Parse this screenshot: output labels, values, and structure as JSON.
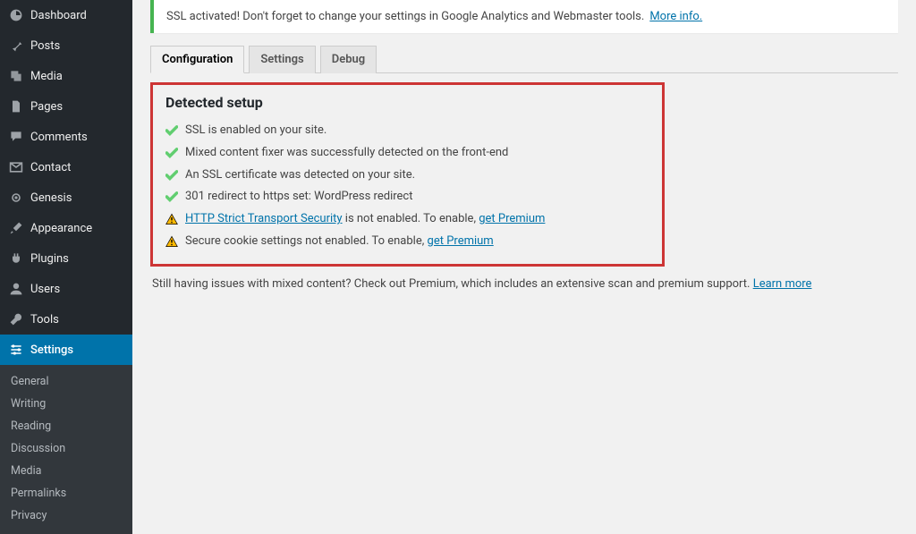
{
  "sidebar": {
    "items": [
      {
        "label": "Dashboard"
      },
      {
        "label": "Posts"
      },
      {
        "label": "Media"
      },
      {
        "label": "Pages"
      },
      {
        "label": "Comments"
      },
      {
        "label": "Contact"
      },
      {
        "label": "Genesis"
      },
      {
        "label": "Appearance"
      },
      {
        "label": "Plugins"
      },
      {
        "label": "Users"
      },
      {
        "label": "Tools"
      },
      {
        "label": "Settings"
      }
    ],
    "submenu": [
      {
        "label": "General"
      },
      {
        "label": "Writing"
      },
      {
        "label": "Reading"
      },
      {
        "label": "Discussion"
      },
      {
        "label": "Media"
      },
      {
        "label": "Permalinks"
      },
      {
        "label": "Privacy"
      }
    ]
  },
  "notice": {
    "text": "SSL activated!  Don't forget to change your settings in Google Analytics and Webmaster tools.",
    "link": "More info."
  },
  "tabs": [
    {
      "label": "Configuration"
    },
    {
      "label": "Settings"
    },
    {
      "label": "Debug"
    }
  ],
  "panel": {
    "title": "Detected setup",
    "lines": [
      {
        "status": "ok",
        "text": "SSL is enabled on your site."
      },
      {
        "status": "ok",
        "text": "Mixed content fixer was successfully detected on the front-end"
      },
      {
        "status": "ok",
        "text": "An SSL certificate was detected on your site."
      },
      {
        "status": "ok",
        "text": "301 redirect to https set: WordPress redirect"
      },
      {
        "status": "warn",
        "link1": "HTTP Strict Transport Security",
        "mid": " is not enabled. To enable, ",
        "link2": "get Premium"
      },
      {
        "status": "warn",
        "text": "Secure cookie settings not enabled. To enable, ",
        "link2": "get Premium"
      }
    ]
  },
  "bottom": {
    "text": "Still having issues with mixed content? Check out Premium, which includes an extensive scan and premium support.  ",
    "link": "Learn more"
  }
}
